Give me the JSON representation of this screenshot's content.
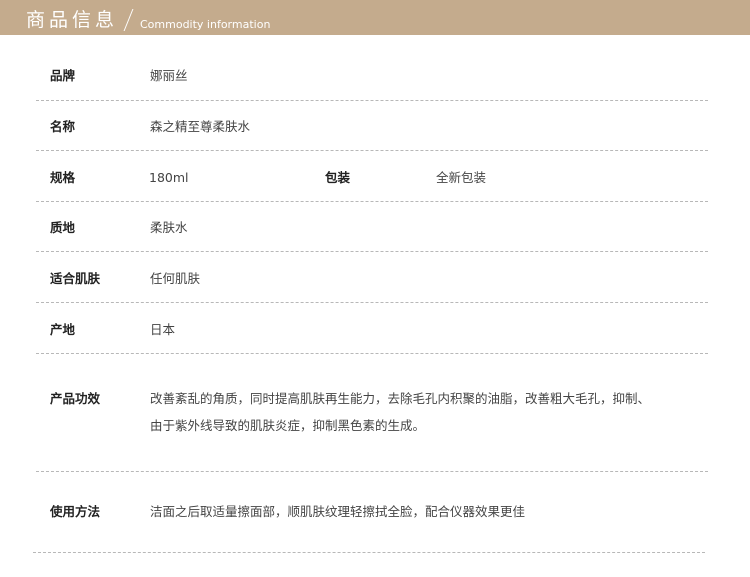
{
  "header": {
    "title": "商品信息",
    "subtitle": "Commodity information"
  },
  "rows": {
    "brand": {
      "label": "品牌",
      "value": "娜丽丝"
    },
    "name": {
      "label": "名称",
      "value": "森之精至尊柔肤水"
    },
    "spec": {
      "label": "规格",
      "value": "180ml"
    },
    "packaging": {
      "label": "包装",
      "value": "全新包装"
    },
    "texture": {
      "label": "质地",
      "value": "柔肤水"
    },
    "skin_type": {
      "label": "适合肌肤",
      "value": "任何肌肤"
    },
    "origin": {
      "label": "产地",
      "value": "日本"
    },
    "efficacy": {
      "label": "产品功效",
      "lines": [
        "改善紊乱的角质，同时提高肌肤再生能力，去除毛孔内积聚的油脂，改善粗大毛孔，抑制、",
        "由于紫外线导致的肌肤炎症，抑制黑色素的生成。"
      ]
    },
    "usage": {
      "label": "使用方法",
      "value": "洁面之后取适量擦面部，顺肌肤纹理轻擦拭全脸，配合仪器效果更佳"
    }
  }
}
